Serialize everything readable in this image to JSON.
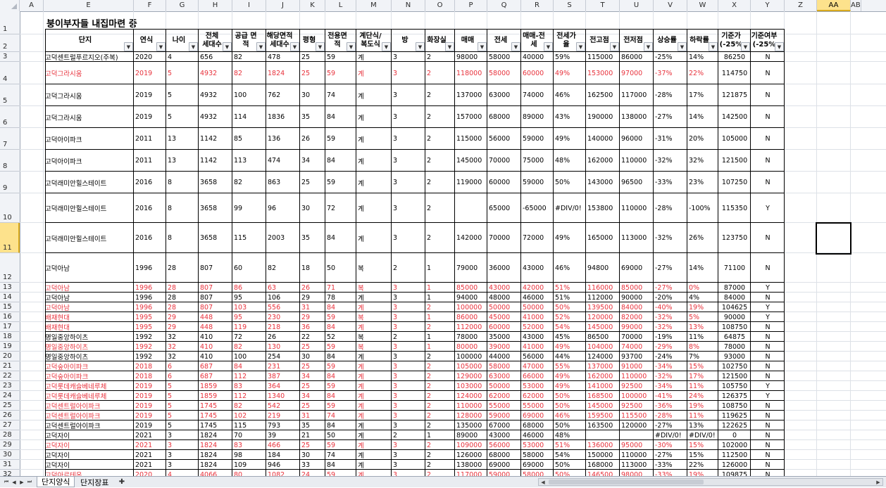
{
  "column_headers": [
    "A",
    "E",
    "F",
    "G",
    "H",
    "I",
    "J",
    "K",
    "L",
    "M",
    "N",
    "O",
    "P",
    "Q",
    "R",
    "S",
    "T",
    "U",
    "V",
    "W",
    "X",
    "Y",
    "Z",
    "AA",
    "AB"
  ],
  "selected_column": "AA",
  "selected_row": "11",
  "title": "붕이부자들 내집마련 중",
  "table_headers": [
    "단지",
    "연식",
    "나이",
    "전체\n세대수",
    "공급 면적",
    "해당면적\n세대수",
    "평형",
    "전용면적",
    "계단식/\n복도식",
    "방",
    "화장실",
    "매매",
    "전세",
    "매매-전세",
    "전세가율",
    "전고점",
    "전저점",
    "상승률",
    "하락률",
    "기준가\n(-25%",
    "기준여부\n(-25%"
  ],
  "red_color": "#e8323c",
  "rows": [
    {
      "n": "3",
      "red": false,
      "c": [
        "고덕센트럴푸르지오(주복)",
        "2020",
        "4",
        "656",
        "82",
        "478",
        "25",
        "59",
        "계",
        "3",
        "2",
        "98000",
        "58000",
        "40000",
        "59%",
        "115000",
        "86000",
        "-25%",
        "14%",
        "86250",
        "N"
      ]
    },
    {
      "n": "4",
      "red": true,
      "c": [
        "고덕그라시움",
        "2019",
        "5",
        "4932",
        "82",
        "1824",
        "25",
        "59",
        "계",
        "3",
        "2",
        "118000",
        "58000",
        "60000",
        "49%",
        "153000",
        "97000",
        "-37%",
        "22%",
        "114750",
        "N"
      ]
    },
    {
      "n": "5",
      "red": false,
      "c": [
        "고덕그라시움",
        "2019",
        "5",
        "4932",
        "100",
        "762",
        "30",
        "74",
        "계",
        "3",
        "2",
        "137000",
        "63000",
        "74000",
        "46%",
        "162500",
        "117000",
        "-28%",
        "17%",
        "121875",
        "N"
      ]
    },
    {
      "n": "6",
      "red": false,
      "c": [
        "고덕그라시움",
        "2019",
        "5",
        "4932",
        "114",
        "1836",
        "35",
        "84",
        "계",
        "3",
        "2",
        "157000",
        "68000",
        "89000",
        "43%",
        "190000",
        "138000",
        "-27%",
        "14%",
        "142500",
        "N"
      ]
    },
    {
      "n": "7",
      "red": false,
      "c": [
        "고덕아이파크",
        "2011",
        "13",
        "1142",
        "85",
        "136",
        "26",
        "59",
        "계",
        "3",
        "2",
        "115000",
        "56000",
        "59000",
        "49%",
        "140000",
        "96000",
        "-31%",
        "20%",
        "105000",
        "N"
      ]
    },
    {
      "n": "8",
      "red": false,
      "c": [
        "고덕아이파크",
        "2011",
        "13",
        "1142",
        "113",
        "474",
        "34",
        "84",
        "계",
        "3",
        "2",
        "145000",
        "70000",
        "75000",
        "48%",
        "162000",
        "110000",
        "-32%",
        "32%",
        "121500",
        "N"
      ]
    },
    {
      "n": "9",
      "red": false,
      "c": [
        "고덕래미안힐스테이트",
        "2016",
        "8",
        "3658",
        "82",
        "863",
        "25",
        "59",
        "계",
        "3",
        "2",
        "119000",
        "60000",
        "59000",
        "50%",
        "143000",
        "96500",
        "-33%",
        "23%",
        "107250",
        "N"
      ]
    },
    {
      "n": "10",
      "red": false,
      "c": [
        "고덕래미안힐스테이트",
        "2016",
        "8",
        "3658",
        "99",
        "96",
        "30",
        "72",
        "계",
        "3",
        "2",
        "",
        "65000",
        "-65000",
        "#DIV/0!",
        "153800",
        "110000",
        "-28%",
        "-100%",
        "115350",
        "Y"
      ]
    },
    {
      "n": "11",
      "red": false,
      "c": [
        "고덕래미안힐스테이트",
        "2016",
        "8",
        "3658",
        "115",
        "2003",
        "35",
        "84",
        "계",
        "3",
        "2",
        "142000",
        "70000",
        "72000",
        "49%",
        "165000",
        "113000",
        "-32%",
        "26%",
        "123750",
        "N"
      ]
    },
    {
      "n": "12",
      "red": false,
      "c": [
        "고덕아남",
        "1996",
        "28",
        "807",
        "60",
        "82",
        "18",
        "50",
        "복",
        "2",
        "1",
        "79000",
        "36000",
        "43000",
        "46%",
        "94800",
        "69000",
        "-27%",
        "14%",
        "71100",
        "N"
      ]
    },
    {
      "n": "13",
      "red": true,
      "c": [
        "고덕아남",
        "1996",
        "28",
        "807",
        "86",
        "63",
        "26",
        "71",
        "복",
        "3",
        "1",
        "85000",
        "43000",
        "42000",
        "51%",
        "116000",
        "85000",
        "-27%",
        "0%",
        "87000",
        "Y"
      ]
    },
    {
      "n": "14",
      "red": false,
      "c": [
        "고덕아남",
        "1996",
        "28",
        "807",
        "95",
        "106",
        "29",
        "78",
        "계",
        "3",
        "1",
        "94000",
        "48000",
        "46000",
        "51%",
        "112000",
        "90000",
        "-20%",
        "4%",
        "84000",
        "N"
      ]
    },
    {
      "n": "15",
      "red": true,
      "c": [
        "고덕아남",
        "1996",
        "28",
        "807",
        "103",
        "556",
        "31",
        "84",
        "계",
        "3",
        "2",
        "100000",
        "50000",
        "50000",
        "50%",
        "139500",
        "84000",
        "-40%",
        "19%",
        "104625",
        "Y"
      ]
    },
    {
      "n": "16",
      "red": true,
      "c": [
        "배재현대",
        "1995",
        "29",
        "448",
        "95",
        "230",
        "29",
        "59",
        "복",
        "3",
        "1",
        "86000",
        "45000",
        "41000",
        "52%",
        "120000",
        "82000",
        "-32%",
        "5%",
        "90000",
        "Y"
      ]
    },
    {
      "n": "17",
      "red": true,
      "c": [
        "배재현대",
        "1995",
        "29",
        "448",
        "119",
        "218",
        "36",
        "84",
        "계",
        "3",
        "2",
        "112000",
        "60000",
        "52000",
        "54%",
        "145000",
        "99000",
        "-32%",
        "13%",
        "108750",
        "N"
      ]
    },
    {
      "n": "18",
      "red": false,
      "c": [
        "명일중앙하이츠",
        "1992",
        "32",
        "410",
        "72",
        "26",
        "22",
        "52",
        "복",
        "2",
        "1",
        "78000",
        "35000",
        "43000",
        "45%",
        "86500",
        "70000",
        "-19%",
        "11%",
        "64875",
        "N"
      ]
    },
    {
      "n": "19",
      "red": true,
      "c": [
        "명일중앙하이츠",
        "1992",
        "32",
        "410",
        "82",
        "130",
        "25",
        "59",
        "복",
        "3",
        "1",
        "80000",
        "39000",
        "41000",
        "49%",
        "104000",
        "74000",
        "-29%",
        "8%",
        "78000",
        "N"
      ]
    },
    {
      "n": "20",
      "red": false,
      "c": [
        "명일중앙하이츠",
        "1992",
        "32",
        "410",
        "100",
        "254",
        "30",
        "84",
        "계",
        "3",
        "2",
        "100000",
        "44000",
        "56000",
        "44%",
        "124000",
        "93700",
        "-24%",
        "7%",
        "93000",
        "N"
      ]
    },
    {
      "n": "21",
      "red": true,
      "c": [
        "고덕숲아이파크",
        "2018",
        "6",
        "687",
        "84",
        "231",
        "25",
        "59",
        "계",
        "3",
        "2",
        "105000",
        "58000",
        "47000",
        "55%",
        "137000",
        "91000",
        "-34%",
        "15%",
        "102750",
        "N"
      ]
    },
    {
      "n": "22",
      "red": true,
      "c": [
        "고덕숲아이파크",
        "2018",
        "6",
        "687",
        "112",
        "387",
        "34",
        "84",
        "계",
        "3",
        "2",
        "129000",
        "63000",
        "66000",
        "49%",
        "162000",
        "110000",
        "-32%",
        "17%",
        "121500",
        "N"
      ]
    },
    {
      "n": "23",
      "red": true,
      "c": [
        "고덕롯데캐슬베네루체",
        "2019",
        "5",
        "1859",
        "83",
        "364",
        "25",
        "59",
        "계",
        "3",
        "2",
        "103000",
        "50000",
        "53000",
        "49%",
        "141000",
        "92500",
        "-34%",
        "11%",
        "105750",
        "Y"
      ]
    },
    {
      "n": "24",
      "red": true,
      "c": [
        "고덕롯데캐슬베네루체",
        "2019",
        "5",
        "1859",
        "112",
        "1340",
        "34",
        "84",
        "계",
        "3",
        "2",
        "124000",
        "62000",
        "62000",
        "50%",
        "168500",
        "100000",
        "-41%",
        "24%",
        "126375",
        "Y"
      ]
    },
    {
      "n": "25",
      "red": true,
      "c": [
        "고덕센트럴아이파크",
        "2019",
        "5",
        "1745",
        "82",
        "542",
        "25",
        "59",
        "계",
        "3",
        "2",
        "110000",
        "55000",
        "55000",
        "50%",
        "145000",
        "92500",
        "-36%",
        "19%",
        "108750",
        "N"
      ]
    },
    {
      "n": "26",
      "red": true,
      "c": [
        "고덕센트럴아이파크",
        "2019",
        "5",
        "1745",
        "102",
        "219",
        "31",
        "74",
        "계",
        "3",
        "2",
        "128000",
        "59000",
        "69000",
        "46%",
        "159500",
        "115500",
        "-28%",
        "11%",
        "119625",
        "N"
      ]
    },
    {
      "n": "27",
      "red": false,
      "c": [
        "고덕센트럴아이파크",
        "2019",
        "5",
        "1745",
        "115",
        "793",
        "35",
        "84",
        "계",
        "3",
        "2",
        "135000",
        "67000",
        "68000",
        "50%",
        "163500",
        "120000",
        "-27%",
        "13%",
        "122625",
        "N"
      ]
    },
    {
      "n": "28",
      "red": false,
      "c": [
        "고덕자이",
        "2021",
        "3",
        "1824",
        "70",
        "39",
        "21",
        "50",
        "계",
        "2",
        "1",
        "89000",
        "43000",
        "46000",
        "48%",
        "",
        "",
        "#DIV/0!",
        "#DIV/0!",
        "0",
        "N"
      ]
    },
    {
      "n": "29",
      "red": true,
      "c": [
        "고덕자이",
        "2021",
        "3",
        "1824",
        "83",
        "466",
        "25",
        "59",
        "계",
        "3",
        "2",
        "109000",
        "56000",
        "53000",
        "51%",
        "136000",
        "95000",
        "-30%",
        "15%",
        "102000",
        "N"
      ]
    },
    {
      "n": "30",
      "red": false,
      "c": [
        "고덕자이",
        "2021",
        "3",
        "1824",
        "98",
        "184",
        "30",
        "74",
        "계",
        "3",
        "2",
        "126000",
        "68000",
        "58000",
        "54%",
        "150000",
        "110000",
        "-27%",
        "15%",
        "112500",
        "N"
      ]
    },
    {
      "n": "31",
      "red": false,
      "c": [
        "고덕자이",
        "2021",
        "3",
        "1824",
        "109",
        "946",
        "33",
        "84",
        "계",
        "3",
        "2",
        "138000",
        "69000",
        "69000",
        "50%",
        "168000",
        "113000",
        "-33%",
        "22%",
        "126000",
        "N"
      ]
    },
    {
      "n": "32",
      "red": true,
      "c": [
        "고덕아르테온",
        "2020",
        "4",
        "4066",
        "80",
        "1082",
        "24",
        "59",
        "계",
        "3",
        "2",
        "117000",
        "59000",
        "58000",
        "50%",
        "146500",
        "98000",
        "-33%",
        "19%",
        "109875",
        "N"
      ]
    }
  ],
  "sheet_tabs": [
    "단지양식",
    "단지장표"
  ]
}
